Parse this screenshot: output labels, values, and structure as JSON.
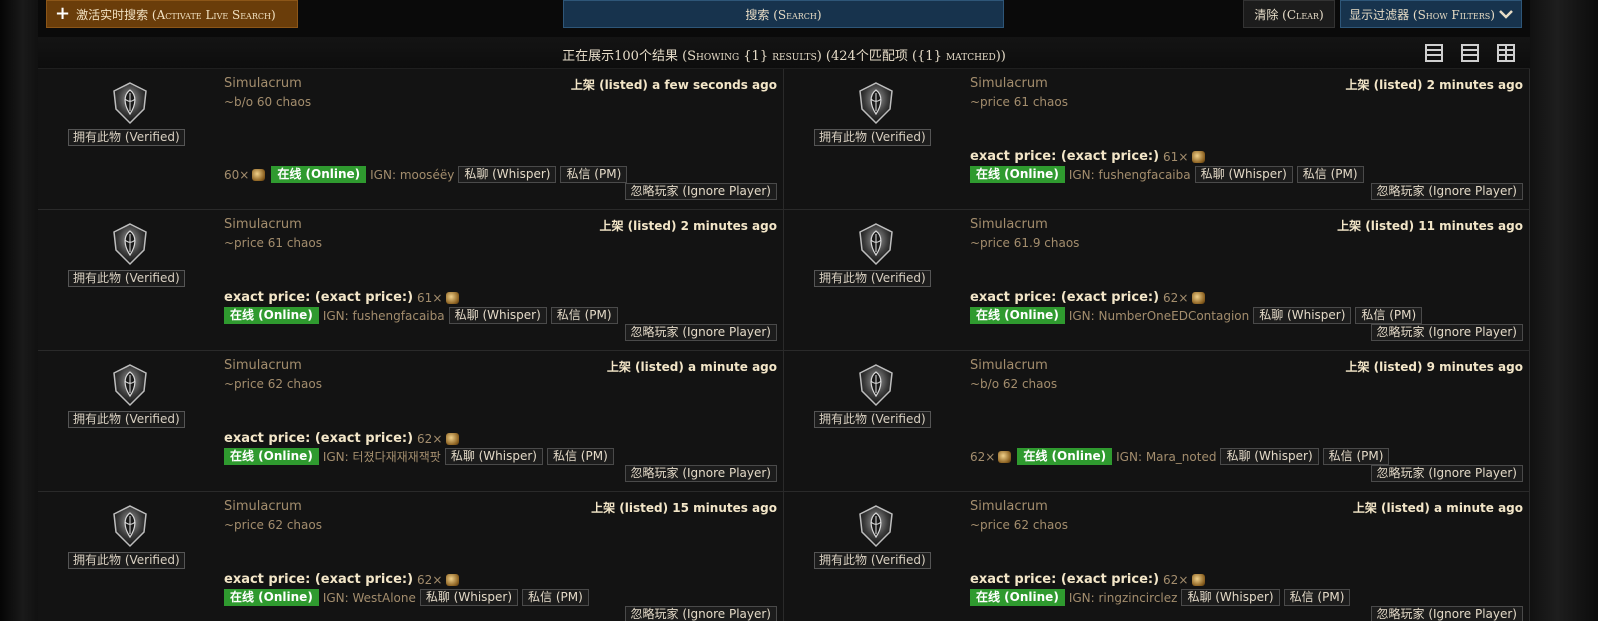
{
  "toolbar": {
    "live_search_label": "激活实时搜索 (Activate Live Search)",
    "search_label": "搜索 (Search)",
    "clear_label": "清除 (Clear)",
    "show_filters_label": "显示过滤器 (Show Filters)"
  },
  "header": {
    "results_text": "正在展示100个结果 (Showing {1} results) (424个匹配项 ({1} matched))"
  },
  "labels": {
    "verified": "拥有此物 (Verified)",
    "online": "在线 (Online)",
    "whisper": "私聊 (Whisper)",
    "pm": "私信 (PM)",
    "ignore": "忽略玩家 (Ignore Player)",
    "exact_price": "exact price: (exact price:)"
  },
  "results": [
    {
      "item_name": "Simulacrum",
      "note": "~b/o 60 chaos",
      "listed": "上架 (listed) a few seconds ago",
      "exact_price": "",
      "price_amount": "60×",
      "ign": "IGN: mooséëy"
    },
    {
      "item_name": "Simulacrum",
      "note": "~price 61 chaos",
      "listed": "上架 (listed) 2 minutes ago",
      "exact_price": "exact price: (exact price:)",
      "price_amount": "61×",
      "ign": "IGN: fushengfacaiba"
    },
    {
      "item_name": "Simulacrum",
      "note": "~price 61 chaos",
      "listed": "上架 (listed) 2 minutes ago",
      "exact_price": "exact price: (exact price:)",
      "price_amount": "61×",
      "ign": "IGN: fushengfacaiba"
    },
    {
      "item_name": "Simulacrum",
      "note": "~price 61.9 chaos",
      "listed": "上架 (listed) 11 minutes ago",
      "exact_price": "exact price: (exact price:)",
      "price_amount": "62×",
      "ign": "IGN: NumberOneEDContagion"
    },
    {
      "item_name": "Simulacrum",
      "note": "~price 62 chaos",
      "listed": "上架 (listed) a minute ago",
      "exact_price": "exact price: (exact price:)",
      "price_amount": "62×",
      "ign": "IGN: 터졌다재재재잭팟"
    },
    {
      "item_name": "Simulacrum",
      "note": "~b/o 62 chaos",
      "listed": "上架 (listed) 9 minutes ago",
      "exact_price": "",
      "price_amount": "62×",
      "ign": "IGN: Mara_noted"
    },
    {
      "item_name": "Simulacrum",
      "note": "~price 62 chaos",
      "listed": "上架 (listed) 15 minutes ago",
      "exact_price": "exact price: (exact price:)",
      "price_amount": "62×",
      "ign": "IGN: WestAlone"
    },
    {
      "item_name": "Simulacrum",
      "note": "~price 62 chaos",
      "listed": "上架 (listed) a minute ago",
      "exact_price": "exact price: (exact price:)",
      "price_amount": "62×",
      "ign": "IGN: ringzincirclez"
    }
  ]
}
